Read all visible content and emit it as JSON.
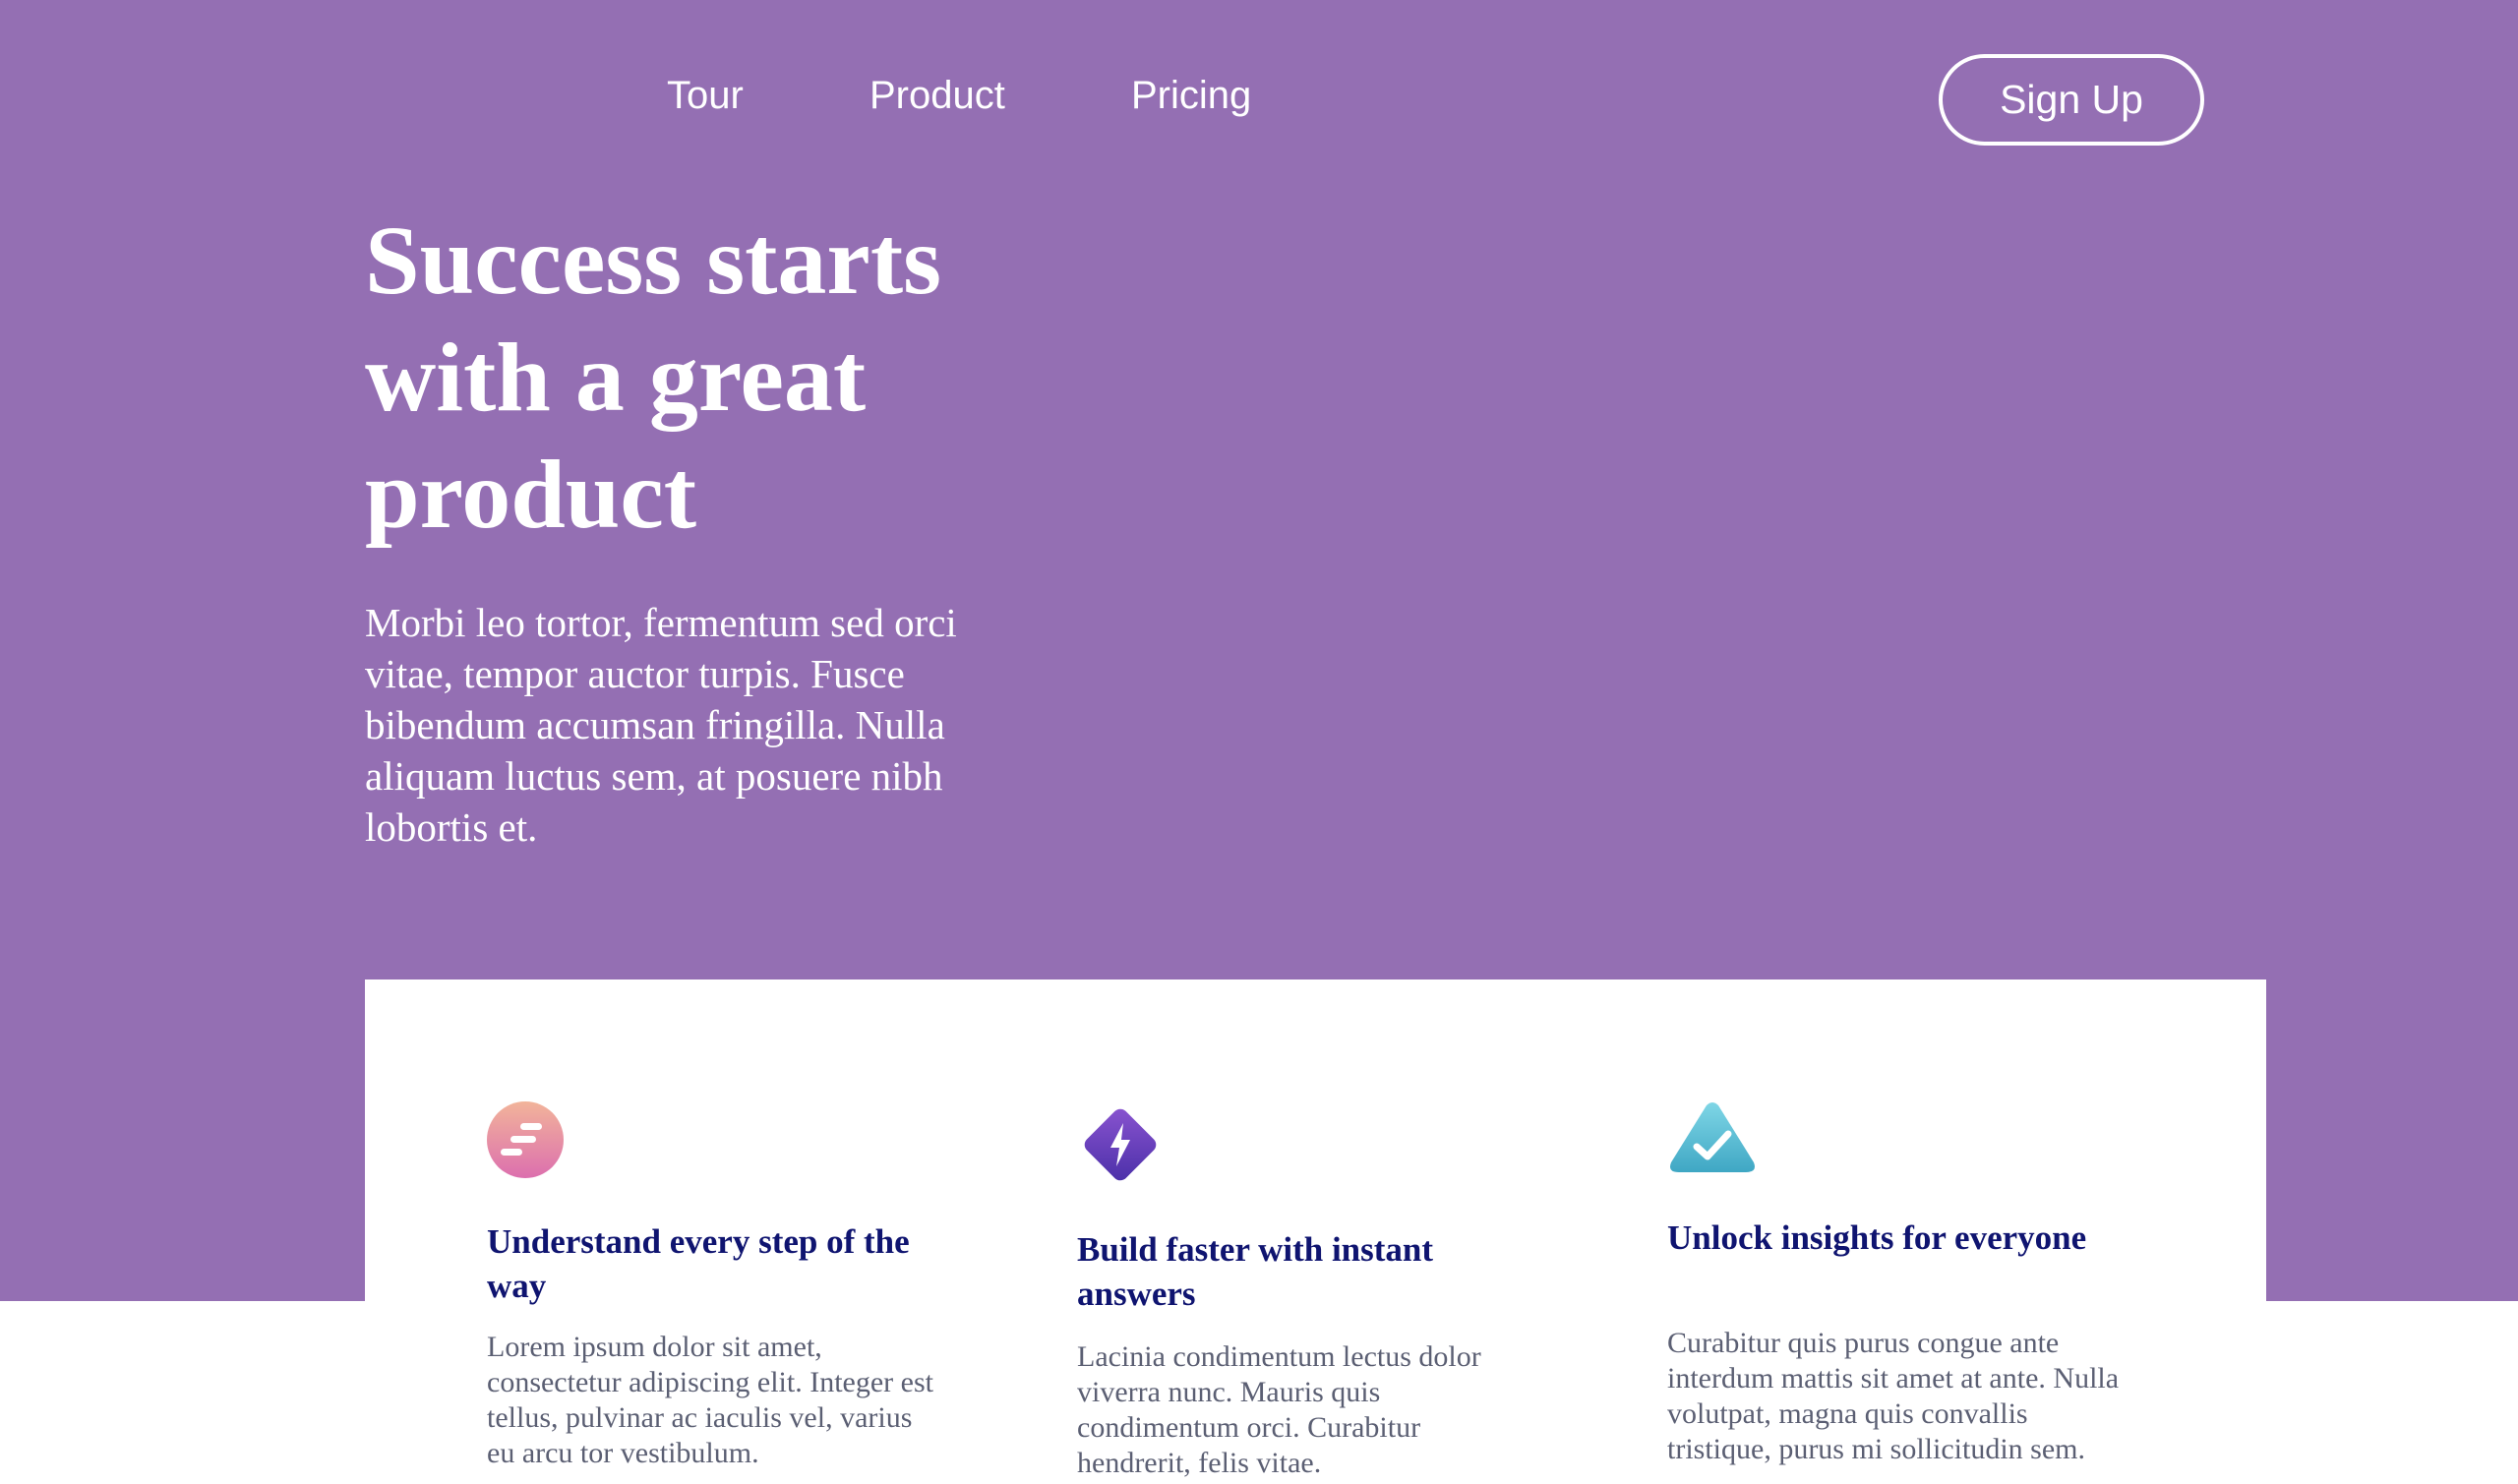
{
  "nav": {
    "links": [
      "Tour",
      "Product",
      "Pricing"
    ],
    "signup_label": "Sign Up"
  },
  "hero": {
    "title": "Success starts with a great product",
    "description": "Morbi leo tortor, fermentum sed orci vitae, tempor auctor turpis. Fusce bibendum accumsan fringilla. Nulla aliquam luctus sem, at posuere nibh lobortis et."
  },
  "features": [
    {
      "icon": "steps-icon",
      "title": "Understand every step of the way",
      "text": "Lorem ipsum dolor sit amet, consectetur adipiscing elit. Integer est tellus, pulvinar ac iaculis vel, varius eu arcu tor vestibulum."
    },
    {
      "icon": "lightning-icon",
      "title": "Build faster with instant answers",
      "text": "Lacinia condimentum lectus dolor viverra nunc. Mauris quis condimentum orci. Curabitur hendrerit, felis vitae."
    },
    {
      "icon": "check-triangle-icon",
      "title": "Unlock insights for everyone",
      "text": "Curabitur quis purus congue ante interdum mattis sit amet at ante. Nulla volutpat, magna quis convallis tristique, purus mi sollicitudin sem."
    }
  ],
  "colors": {
    "hero_background": "#946fb3",
    "heading_navy": "#0f1470",
    "body_gray": "#5b5f73"
  }
}
